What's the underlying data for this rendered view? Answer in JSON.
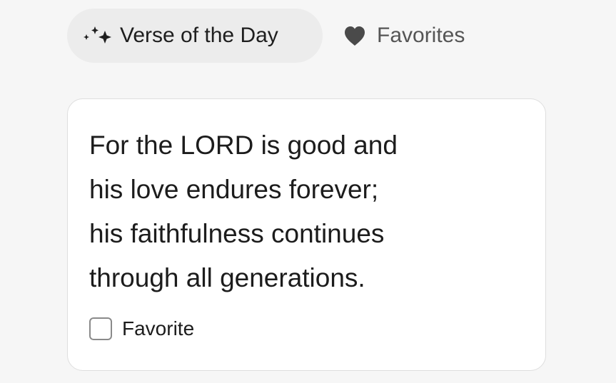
{
  "tabs": [
    {
      "label": "Verse of the Day",
      "icon": "sparkles-icon",
      "active": true
    },
    {
      "label": "Favorites",
      "icon": "heart-icon",
      "active": false
    }
  ],
  "verse": {
    "lines": [
      "For the LORD is good and",
      "his love endures forever;",
      "his faithfulness continues",
      "through all generations."
    ],
    "favorite_label": "Favorite",
    "favorite_checked": false
  },
  "colors": {
    "background": "#f6f6f6",
    "active_tab_bg": "#ececec",
    "card_bg": "#ffffff",
    "card_border": "#dedede",
    "heart": "#4a4a4a",
    "inactive_text": "#555555"
  }
}
